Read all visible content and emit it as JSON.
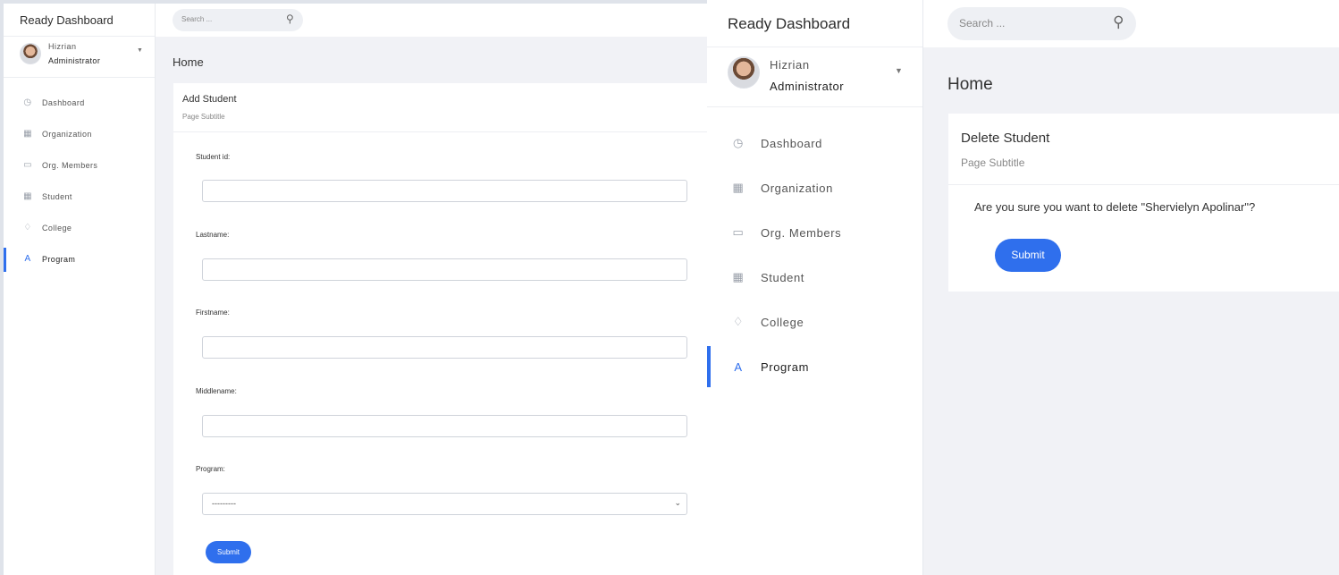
{
  "add_student_view": {
    "app_title": "Ready Dashboard",
    "search": {
      "placeholder": "Search ..."
    },
    "user": {
      "name": "Hizrian",
      "role": "Administrator"
    },
    "sidebar": {
      "items": [
        {
          "label": "Dashboard",
          "icon": "dashboard-icon",
          "active": false
        },
        {
          "label": "Organization",
          "icon": "grid-icon",
          "active": false
        },
        {
          "label": "Org. Members",
          "icon": "keyboard-icon",
          "active": false
        },
        {
          "label": "Student",
          "icon": "table-icon",
          "active": false
        },
        {
          "label": "College",
          "icon": "bell-icon",
          "active": false
        },
        {
          "label": "Program",
          "icon": "letter-a-icon",
          "active": true
        }
      ]
    },
    "breadcrumb": "Home",
    "card": {
      "title": "Add Student",
      "subtitle": "Page Subtitle",
      "fields": [
        {
          "label": "Student id:",
          "value": ""
        },
        {
          "label": "Lastname:",
          "value": ""
        },
        {
          "label": "Firstname:",
          "value": ""
        },
        {
          "label": "Middlename:",
          "value": ""
        }
      ],
      "program": {
        "label": "Program:",
        "selected": "---------"
      },
      "submit_label": "Submit"
    }
  },
  "delete_student_view": {
    "app_title": "Ready Dashboard",
    "search": {
      "placeholder": "Search ..."
    },
    "user": {
      "name": "Hizrian",
      "role": "Administrator"
    },
    "sidebar": {
      "items": [
        {
          "label": "Dashboard",
          "icon": "dashboard-icon",
          "active": false
        },
        {
          "label": "Organization",
          "icon": "grid-icon",
          "active": false
        },
        {
          "label": "Org. Members",
          "icon": "keyboard-icon",
          "active": false
        },
        {
          "label": "Student",
          "icon": "table-icon",
          "active": false
        },
        {
          "label": "College",
          "icon": "bell-icon",
          "active": false
        },
        {
          "label": "Program",
          "icon": "letter-a-icon",
          "active": true
        }
      ]
    },
    "breadcrumb": "Home",
    "card": {
      "title": "Delete Student",
      "subtitle": "Page Subtitle",
      "message": "Are you sure you want to delete \"Shervielyn Apolinar\"?",
      "submit_label": "Submit"
    }
  },
  "colors": {
    "accent": "#2f6fed",
    "background": "#f1f2f6",
    "card": "#ffffff"
  }
}
